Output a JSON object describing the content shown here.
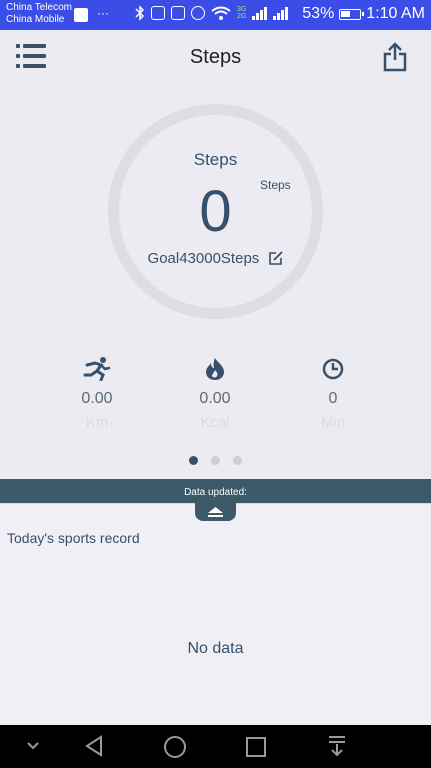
{
  "status_bar": {
    "carrier1": "China Telecom",
    "carrier2": "China Mobile",
    "more": "···",
    "net1": "3G",
    "net2": "2G",
    "battery": "53%",
    "time": "1:10 AM"
  },
  "header": {
    "title": "Steps"
  },
  "ring": {
    "title": "Steps",
    "value": "0",
    "unit": "Steps",
    "goal": "Goal43000Steps"
  },
  "stats": [
    {
      "icon": "running-icon",
      "value": "0.00",
      "unit": "Km"
    },
    {
      "icon": "flame-icon",
      "value": "0.00",
      "unit": "Kcal"
    },
    {
      "icon": "clock-icon",
      "value": "0",
      "unit": "Min"
    }
  ],
  "pager": {
    "count": 3,
    "active": 0
  },
  "banner": {
    "text": "Data updated:"
  },
  "records": {
    "title": "Today's sports record",
    "empty": "No data"
  },
  "colors": {
    "status_bar": "#3a4de6",
    "accent": "#37506b",
    "banner": "#3c5a69",
    "background": "#ecebf1"
  }
}
